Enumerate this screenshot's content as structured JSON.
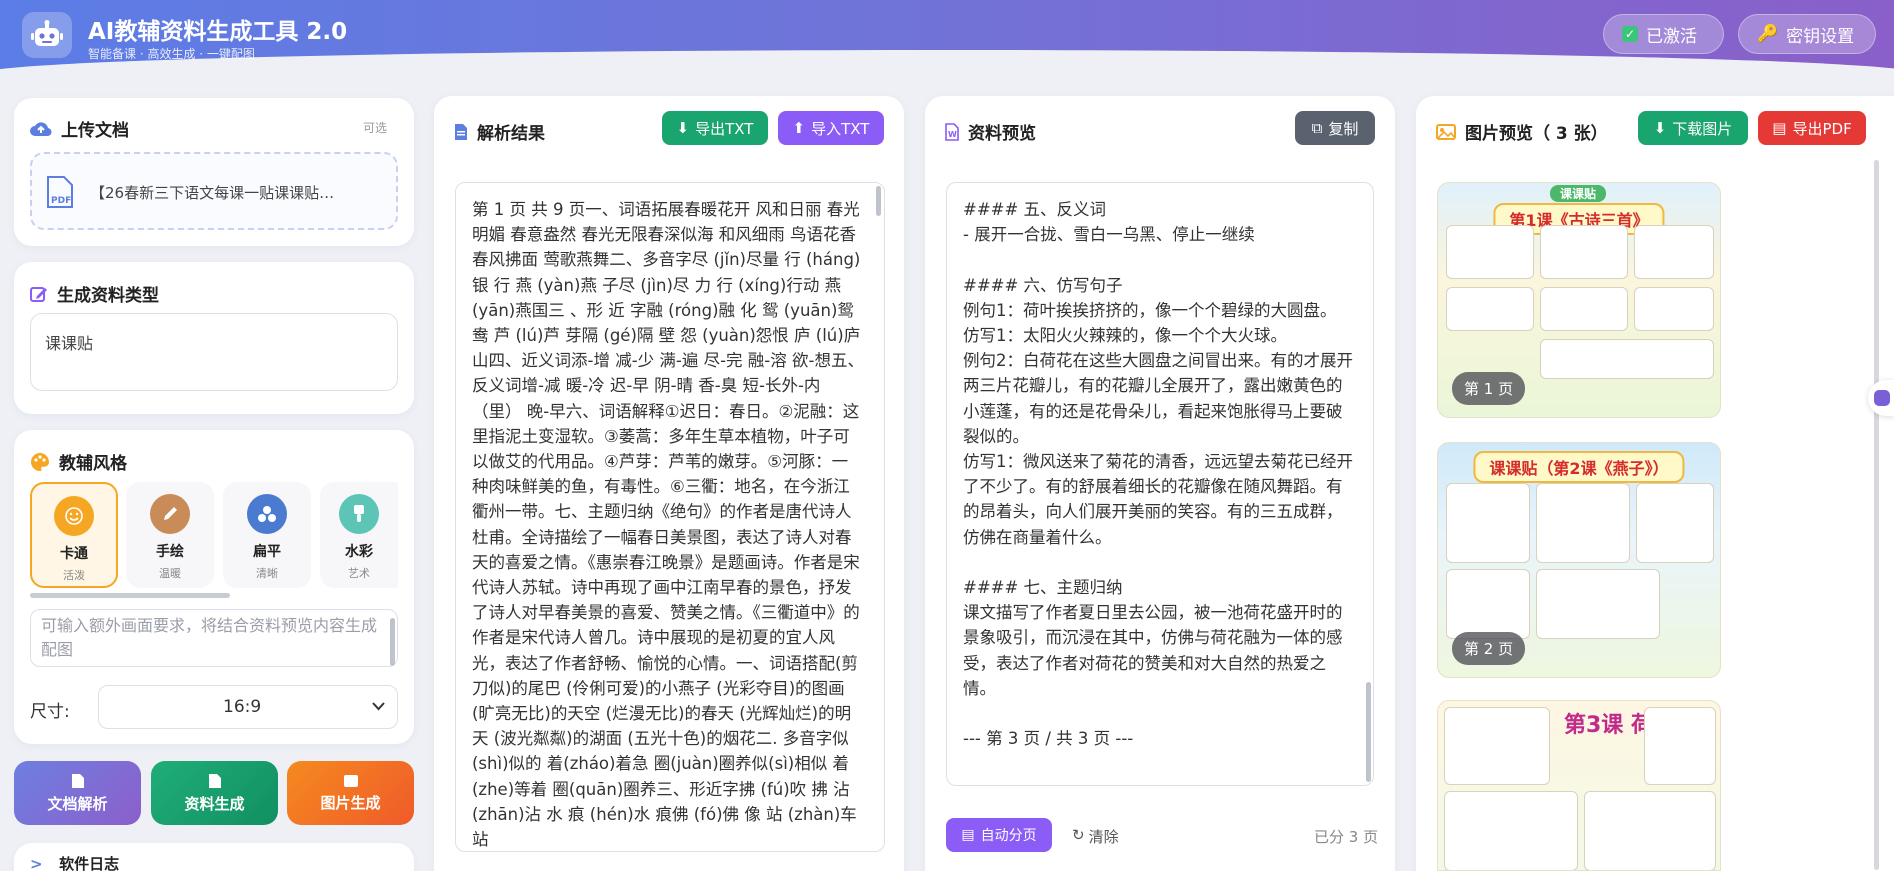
{
  "header": {
    "title": "AI教辅资料生成工具 2.0",
    "subtitle": "智能备课 · 高效生成 · 一键配图",
    "activated_label": "已激活",
    "key_settings_label": "密钥设置"
  },
  "upload": {
    "title": "上传文档",
    "optional": "可选",
    "file_name": "【26春新三下语文每课一贴课课贴…"
  },
  "gen_type": {
    "title": "生成资料类型",
    "value": "课课贴"
  },
  "styles": {
    "title": "教辅风格",
    "items": [
      {
        "name": "卡通",
        "desc": "活泼"
      },
      {
        "name": "手绘",
        "desc": "温暖"
      },
      {
        "name": "扁平",
        "desc": "清晰"
      },
      {
        "name": "水彩",
        "desc": "艺术"
      }
    ],
    "extra_placeholder": "可输入额外画面要求，将结合资料预览内容生成配图",
    "size_label": "尺寸:",
    "size_value": "16:9"
  },
  "actions": {
    "parse": "文档解析",
    "generate": "资料生成",
    "image": "图片生成"
  },
  "log": {
    "title": "软件日志"
  },
  "parse_panel": {
    "title": "解析结果",
    "export_txt": "导出TXT",
    "import_txt": "导入TXT",
    "content": "第 1 页 共 9 页一、词语拓展春暖花开 风和日丽 春光明媚 春意盎然 春光无限春深似海 和风细雨 鸟语花香 春风拂面 莺歌燕舞二、多音字尽 (jǐn)尽量 行 (háng)银 行 燕 (yàn)燕 子尽 (jìn)尽 力 行 (xíng)行动 燕 (yān)燕国三 、形 近 字融 (róng)融 化 鸳 (yuān)鸳鸯 芦 (lú)芦 芽隔 (gé)隔 壁 怨 (yuàn)怨恨 庐 (lú)庐 山四、近义词添-增 减-少 满-遍 尽-完 融-溶 欲-想五、反义词增-减 暖-冷 迟-早 阴-晴 香-臭 短-长外-内（里） 晚-早六、词语解释①迟日：春日。②泥融：这里指泥土变湿软。③萎蒿：多年生草本植物，叶子可以做艾的代用品。④芦芽：芦苇的嫩芽。⑤河豚：一种肉味鲜美的鱼，有毒性。⑥三衢：地名，在今浙江衢州一带。七、主题归纳《绝句》的作者是唐代诗人杜甫。全诗描绘了一幅春日美景图，表达了诗人对春天的喜爱之情。《惠崇春江晚景》是题画诗。作者是宋代诗人苏轼。诗中再现了画中江南早春的景色，抒发了诗人对早春美景的喜爱、赞美之情。《三衢道中》的作者是宋代诗人曾几。诗中展现的是初夏的宜人风光，表达了作者舒畅、愉悦的心情。一、词语搭配(剪刀似)的尾巴 (伶俐可爱)的小燕子 (光彩夺目)的图画(旷亮无比)的天空 (烂漫无比)的春天 (光辉灿烂)的明天 (波光粼粼)的湖面 (五光十色)的烟花二. 多音字似 (shì)似的 着(zháo)着急 圈(juàn)圈养似(sì)相似 着(zhe)等着 圈(quān)圈养三、形近字拂 (fú)吹 拂 沾 (zhān)沾 水 痕 (hén)水 痕佛 (fó)佛 像 站 (zhàn)车站"
  },
  "preview_panel": {
    "title": "资料预览",
    "copy_label": "复制",
    "content": "#### 五、反义词\n- 展开一合拢、雪白一乌黑、停止一继续\n\n#### 六、仿写句子\n例句1：荷叶挨挨挤挤的，像一个个碧绿的大圆盘。\n仿写1：太阳火火辣辣的，像一个个大火球。\n例句2：白荷花在这些大圆盘之间冒出来。有的才展开两三片花瓣儿，有的花瓣儿全展开了，露出嫩黄色的小莲蓬，有的还是花骨朵儿，看起来饱胀得马上要破裂似的。\n仿写1：微风送来了菊花的清香，远远望去菊花已经开了不少了。有的舒展着细长的花瓣像在随风舞蹈。有的昂着头，向人们展开美丽的笑容。有的三五成群，仿佛在商量着什么。\n\n#### 七、主题归纳\n课文描写了作者夏日里去公园，被一池荷花盛开时的景象吸引，而沉浸在其中，仿佛与荷花融为一体的感受，表达了作者对荷花的赞美和对大自然的热爱之情。\n\n--- 第 3 页 / 共 3 页 ---",
    "auto_paginate": "自动分页",
    "clear": "清除",
    "page_count": "已分 3 页"
  },
  "image_panel": {
    "title": "图片预览（ 3 张）",
    "download_label": "下载图片",
    "export_pdf_label": "导出PDF",
    "thumbnails": [
      {
        "page_label": "第 1 页",
        "banner": "第1课《古诗三首》",
        "tag": "课课贴"
      },
      {
        "page_label": "第 2 页",
        "banner": "课课贴（第2课《燕子》）",
        "tag": ""
      },
      {
        "page_label": "",
        "banner": "第3课  荷花",
        "tag": ""
      }
    ]
  },
  "colors": {
    "header_start": "#5c7de6",
    "header_end": "#8a5fc9",
    "green": "#1ba56e",
    "purple": "#8b5cf6",
    "red": "#e53935",
    "orange": "#f57c1f",
    "gray": "#5a6270"
  }
}
